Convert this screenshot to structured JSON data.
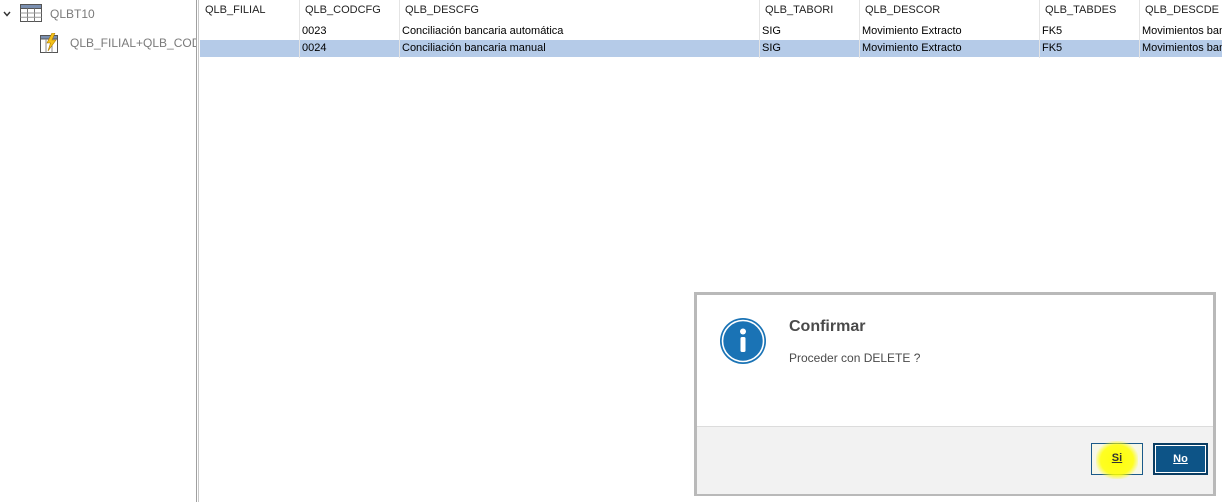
{
  "tree": {
    "root": {
      "label": "QLBT10",
      "icon": "table-icon",
      "chevron": "chevron-down-icon"
    },
    "child": {
      "label": "QLB_FILIAL+QLB_CODCFG",
      "icon": "index-lightning-icon"
    }
  },
  "grid": {
    "columns": [
      "QLB_FILIAL",
      "QLB_CODCFG",
      "QLB_DESCFG",
      "QLB_TABORI",
      "QLB_DESCOR",
      "QLB_TABDES",
      "QLB_DESCDE"
    ],
    "rows": [
      [
        "",
        "0023",
        "Conciliación bancaria automática",
        "SIG",
        "Movimiento Extracto",
        "FK5",
        "Movimientos ban"
      ],
      [
        "",
        "0024",
        "Conciliación bancaria manual",
        "SIG",
        "Movimiento Extracto",
        "FK5",
        "Movimientos ban"
      ]
    ],
    "selected_row": 1
  },
  "dialog": {
    "title": "Confirmar",
    "message": "Proceder con DELETE ?",
    "icon": "info-icon",
    "yes_label": "Si",
    "no_label": "No"
  },
  "colors": {
    "selection": "#b5cbe8",
    "primary_button": "#0d5487",
    "info_icon": "#1a73b5",
    "highlight": "#ffff00"
  }
}
